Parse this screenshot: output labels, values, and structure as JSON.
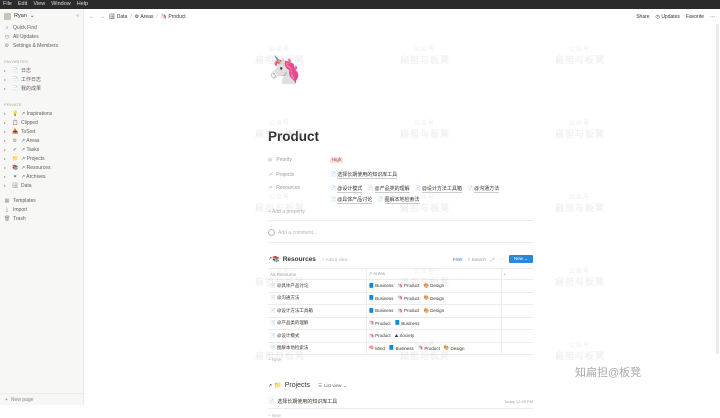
{
  "menubar": [
    "File",
    "Edit",
    "View",
    "Window",
    "Help"
  ],
  "sidebar": {
    "workspace": "Ryan",
    "top_items": [
      {
        "icon": "search-icon",
        "glyph": "⌕",
        "label": "Quick Find"
      },
      {
        "icon": "clock-icon",
        "glyph": "◷",
        "label": "All Updates"
      },
      {
        "icon": "gear-icon",
        "glyph": "⚙",
        "label": "Settings & Members"
      }
    ],
    "favorites_heading": "FAVORITES",
    "favorites": [
      {
        "glyph": "📄",
        "label": "日志"
      },
      {
        "glyph": "📄",
        "label": "工作日志"
      },
      {
        "glyph": "📄",
        "label": "我的成果"
      }
    ],
    "private_heading": "PRIVATE",
    "private": [
      {
        "glyph": "💡",
        "label": "↗ Inspirations"
      },
      {
        "glyph": "📋",
        "label": "Clipped"
      },
      {
        "glyph": "📥",
        "label": "ToSort"
      },
      {
        "glyph": "⚙",
        "label": "↗ Areas"
      },
      {
        "glyph": "✔",
        "label": "↗ Tasks"
      },
      {
        "glyph": "📁",
        "label": "↗ Projects"
      },
      {
        "glyph": "📚",
        "label": "↗ Resources"
      },
      {
        "glyph": "⚫",
        "label": "↗ Archives"
      },
      {
        "glyph": "🗄",
        "label": "Data"
      }
    ],
    "bottom_items": [
      {
        "glyph": "▦",
        "label": "Templates"
      },
      {
        "glyph": "⤓",
        "label": "Import"
      },
      {
        "glyph": "🗑",
        "label": "Trash"
      }
    ],
    "new_page": "New page"
  },
  "topbar": {
    "breadcrumb": [
      {
        "glyph": "🗄",
        "label": "Data"
      },
      {
        "glyph": "⚙",
        "label": "Areas"
      },
      {
        "glyph": "🦄",
        "label": "Product"
      }
    ],
    "share": "Share",
    "updates": "Updates",
    "favorite": "Favorite",
    "more": "···"
  },
  "page": {
    "icon": "🦄",
    "title": "Product",
    "properties": [
      {
        "icon": "◎",
        "name": "Priority",
        "type": "tag",
        "value": "High"
      },
      {
        "icon": "↗",
        "name": "Projects",
        "type": "links",
        "values": [
          "选择长期使用的知识库工具"
        ]
      },
      {
        "icon": "↗",
        "name": "Resources",
        "type": "links",
        "values": [
          "@设计模式",
          "@产品类的理解",
          "@设计方法工具箱",
          "@沟通方法",
          "@具体产品讨论",
          "图解本地检索法"
        ]
      }
    ],
    "add_property": "+ Add a property",
    "add_comment": "Add a comment..."
  },
  "resources_db": {
    "title": "Resources",
    "add_view": "+ Add a view",
    "filter": "Filter",
    "search": "Search",
    "new_label": "New",
    "col1": "Resource",
    "col2": "Areas",
    "rows": [
      {
        "name": "@具体产品讨论",
        "areas": [
          {
            "g": "📘",
            "t": "Business"
          },
          {
            "g": "🦄",
            "t": "Product"
          },
          {
            "g": "🎨",
            "t": "Design"
          }
        ]
      },
      {
        "name": "@沟通方法",
        "areas": [
          {
            "g": "📘",
            "t": "Business"
          },
          {
            "g": "🦄",
            "t": "Product"
          },
          {
            "g": "🎨",
            "t": "Design"
          }
        ]
      },
      {
        "name": "@设计方法工具箱",
        "areas": [
          {
            "g": "📘",
            "t": "Business"
          },
          {
            "g": "🦄",
            "t": "Product"
          },
          {
            "g": "🎨",
            "t": "Design"
          }
        ]
      },
      {
        "name": "@产品类的理解",
        "areas": [
          {
            "g": "🦄",
            "t": "Product"
          },
          {
            "g": "📘",
            "t": "Business"
          }
        ]
      },
      {
        "name": "@设计模式",
        "areas": [
          {
            "g": "🦄",
            "t": "Product"
          },
          {
            "g": "⛰",
            "t": "Society"
          }
        ]
      },
      {
        "name": "图解本地检索法",
        "areas": [
          {
            "g": "🧠",
            "t": "Mind"
          },
          {
            "g": "📘",
            "t": "Business"
          },
          {
            "g": "🦄",
            "t": "Product"
          },
          {
            "g": "🎨",
            "t": "Design"
          }
        ]
      }
    ],
    "new_row": "+ New"
  },
  "projects_db": {
    "title": "Projects",
    "view": "List view",
    "rows": [
      {
        "name": "选择长期使用的知识库工具",
        "date": "Today 12:49 PM"
      }
    ],
    "new_row": "+ New"
  },
  "watermark": "扁担与板凳",
  "watermark_sub": "公众号",
  "brand_mark": "知扁担@板凳"
}
